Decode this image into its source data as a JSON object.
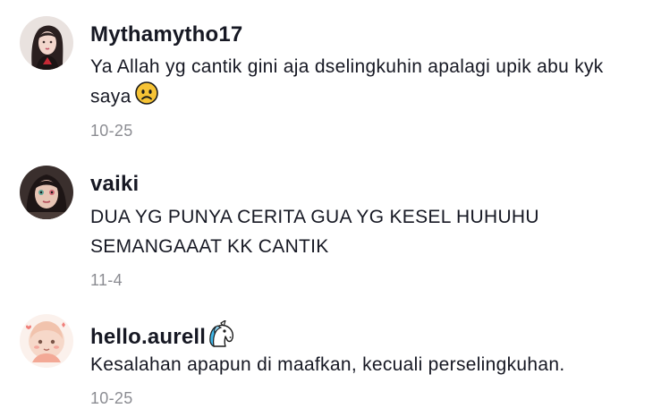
{
  "comments": [
    {
      "username": "Mythamytho17",
      "text": "Ya Allah yg cantik gini aja dselingkuhin apalagi upik abu kyk saya",
      "emoji": "worried-face",
      "date": "10-25",
      "avatar": "avatar-woman-dark-hair"
    },
    {
      "username": "vaiki",
      "text_lines": [
        "DUA YG PUNYA CERITA GUA YG KESEL HUHUHU",
        "SEMANGAAAT KK CANTIK"
      ],
      "date": "11-4",
      "avatar": "avatar-woman-selfie"
    },
    {
      "username": "hello.aurell",
      "username_emoji": "unicorn",
      "text": "Kesalahan apapun di maafkan, kecuali perselingkuhan.",
      "date": "10-25",
      "avatar": "avatar-cartoon-girl"
    }
  ],
  "colors": {
    "text_primary": "#161823",
    "text_secondary": "#8a8b91",
    "emoji_yellow": "#f6c335",
    "unicorn_blue": "#3fb6e8"
  }
}
